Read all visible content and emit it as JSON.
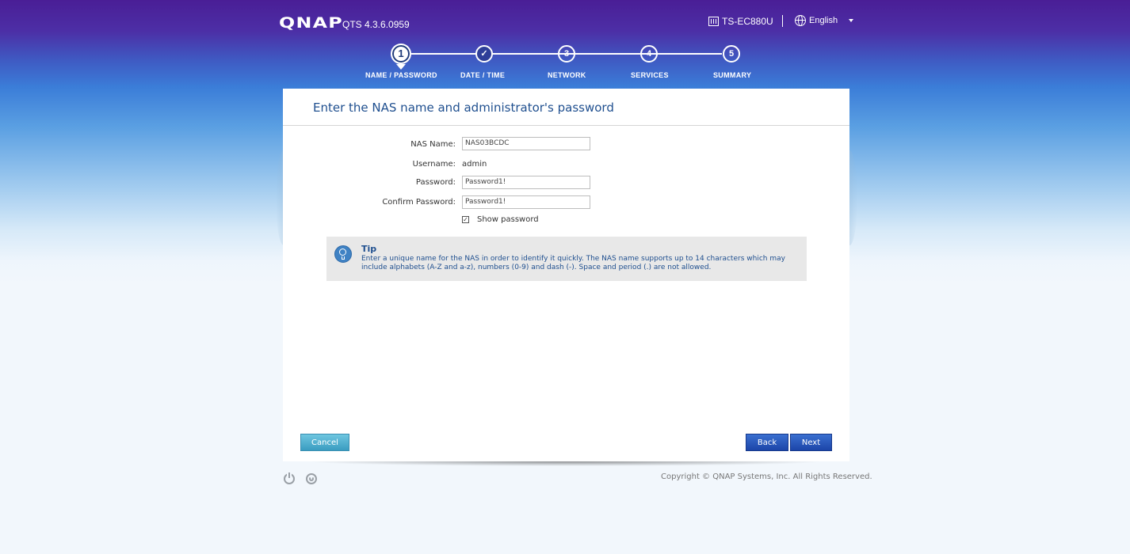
{
  "header": {
    "logo": "QNAP",
    "version": "QTS 4.3.6.0959",
    "model": "TS-EC880U",
    "language": "English"
  },
  "steps": [
    {
      "number": "1",
      "label": "NAME / PASSWORD",
      "state": "active"
    },
    {
      "number": "✓",
      "label": "DATE / TIME",
      "state": "done"
    },
    {
      "number": "3",
      "label": "NETWORK",
      "state": "pending"
    },
    {
      "number": "4",
      "label": "SERVICES",
      "state": "pending"
    },
    {
      "number": "5",
      "label": "SUMMARY",
      "state": "pending"
    }
  ],
  "form": {
    "title": "Enter the NAS name and administrator's password",
    "nas_name_label": "NAS Name:",
    "nas_name_value": "NAS03BCDC",
    "username_label": "Username:",
    "username_value": "admin",
    "password_label": "Password:",
    "password_value": "Password1!",
    "confirm_label": "Confirm Password:",
    "confirm_value": "Password1!",
    "show_password_label": "Show password",
    "show_password_checked": true
  },
  "tip": {
    "title": "Tip",
    "text": "Enter a unique name for the NAS in order to identify it quickly. The NAS name supports up to 14 characters which may include alphabets (A-Z and a-z), numbers (0-9) and dash (-). Space and period (.) are not allowed."
  },
  "buttons": {
    "cancel": "Cancel",
    "back": "Back",
    "next": "Next"
  },
  "footer": {
    "copyright": "Copyright © QNAP Systems, Inc. All Rights Reserved."
  },
  "colors": {
    "accent": "#1f4f8f",
    "primary_button": "#1c45a8",
    "cancel_button": "#3a9cc0"
  }
}
